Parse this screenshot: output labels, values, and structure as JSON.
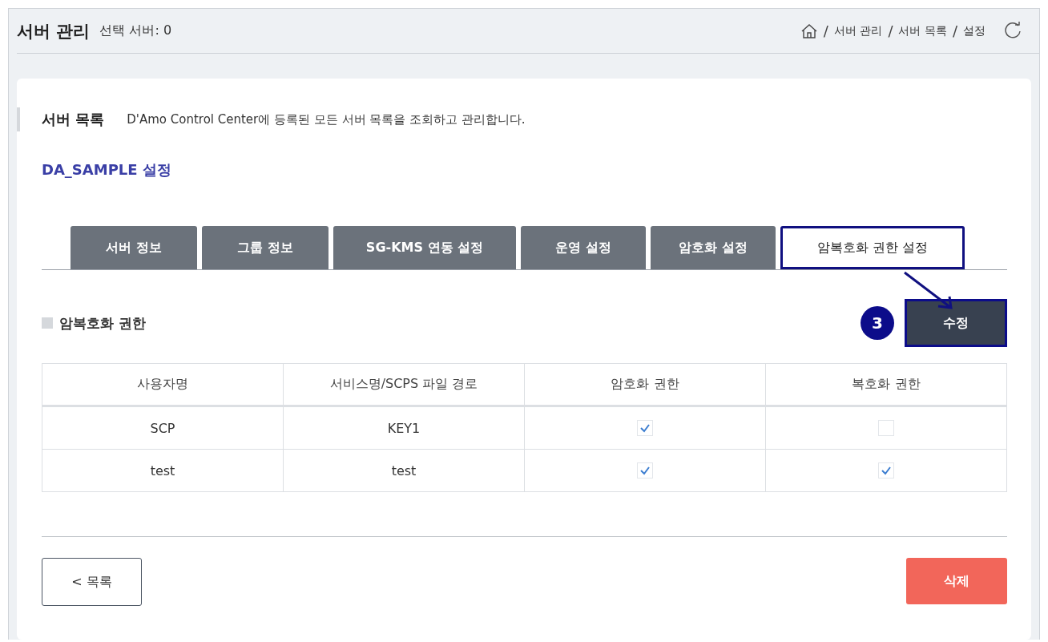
{
  "header": {
    "title": "서버 관리",
    "selected_count": "선택 서버: 0",
    "breadcrumb": [
      {
        "separator": "/",
        "label": "서버 관리"
      },
      {
        "separator": "/",
        "label": "서버 목록"
      },
      {
        "separator": "/",
        "label": "설정"
      }
    ]
  },
  "section": {
    "title": "서버 목록",
    "description": "D'Amo Control Center에 등록된 모든 서버 목록을 조회하고 관리합니다."
  },
  "server_title": "DA_SAMPLE 설정",
  "tabs": [
    {
      "label": "서버 정보",
      "selected": false
    },
    {
      "label": "그룹 정보",
      "selected": false
    },
    {
      "label": "SG-KMS 연동 설정",
      "selected": false
    },
    {
      "label": "운영 설정",
      "selected": false
    },
    {
      "label": "암호화 설정",
      "selected": false
    },
    {
      "label": "암복호화 권한 설정",
      "selected": true
    }
  ],
  "panel": {
    "title": "암복호화 권한",
    "step_badge": "3",
    "edit_button": "수정"
  },
  "table": {
    "columns": [
      "사용자명",
      "서비스명/SCPS 파일 경로",
      "암호화 권한",
      "복호화 권한"
    ],
    "rows": [
      {
        "user": "SCP",
        "service": "KEY1",
        "encrypt": true,
        "decrypt": false
      },
      {
        "user": "test",
        "service": "test",
        "encrypt": true,
        "decrypt": true
      }
    ]
  },
  "footer": {
    "back_button": "< 목록",
    "delete_button": "삭제"
  }
}
